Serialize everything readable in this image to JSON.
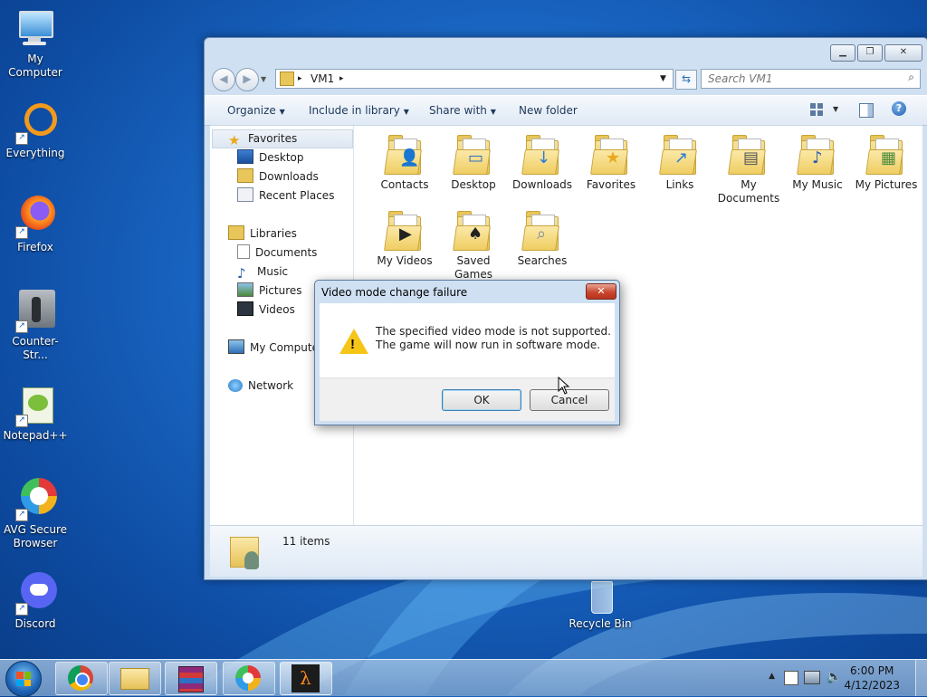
{
  "desktop": {
    "icons": [
      {
        "label": "My Computer",
        "icon": "computer-icon"
      },
      {
        "label": "Everything",
        "icon": "everything-icon"
      },
      {
        "label": "Firefox",
        "icon": "firefox-icon"
      },
      {
        "label": "Counter-Str...",
        "icon": "counter-strike-icon"
      },
      {
        "label": "Notepad++",
        "icon": "notepad-plus-plus-icon"
      },
      {
        "label": "AVG Secure Browser",
        "icon": "avg-browser-icon"
      },
      {
        "label": "Discord",
        "icon": "discord-icon"
      }
    ],
    "recycle_bin": "Recycle Bin"
  },
  "explorer": {
    "address": {
      "root_sep": "▸",
      "path": "VM1",
      "end_sep": "▸"
    },
    "search_placeholder": "Search VM1",
    "toolbar": {
      "organize": "Organize",
      "include_in_library": "Include in library",
      "share_with": "Share with",
      "new_folder": "New folder"
    },
    "nav": {
      "favorites": "Favorites",
      "desktop": "Desktop",
      "downloads": "Downloads",
      "recent_places": "Recent Places",
      "libraries": "Libraries",
      "documents": "Documents",
      "music": "Music",
      "pictures": "Pictures",
      "videos": "Videos",
      "my_computer": "My Computer",
      "network": "Network"
    },
    "items": [
      {
        "label": "Contacts",
        "icon": "contacts-folder-icon"
      },
      {
        "label": "Desktop",
        "icon": "desktop-folder-icon"
      },
      {
        "label": "Downloads",
        "icon": "downloads-folder-icon"
      },
      {
        "label": "Favorites",
        "icon": "favorites-folder-icon"
      },
      {
        "label": "Links",
        "icon": "links-folder-icon"
      },
      {
        "label": "My Documents",
        "icon": "documents-folder-icon"
      },
      {
        "label": "My Music",
        "icon": "music-folder-icon"
      },
      {
        "label": "My Pictures",
        "icon": "pictures-folder-icon"
      },
      {
        "label": "My Videos",
        "icon": "videos-folder-icon"
      },
      {
        "label": "Saved Games",
        "icon": "saved-games-folder-icon"
      },
      {
        "label": "Searches",
        "icon": "searches-folder-icon"
      }
    ],
    "status": "11 items"
  },
  "dialog": {
    "title": "Video mode change failure",
    "close": "✕",
    "message_line1": "The specified video mode is not supported.",
    "message_line2": "The game will now run in software mode.",
    "ok": "OK",
    "cancel": "Cancel"
  },
  "taskbar": {
    "time": "6:00 PM",
    "date": "4/12/2023",
    "apps": [
      "chrome-icon",
      "explorer-icon",
      "winrar-icon",
      "avg-browser-icon",
      "half-life-icon"
    ]
  }
}
